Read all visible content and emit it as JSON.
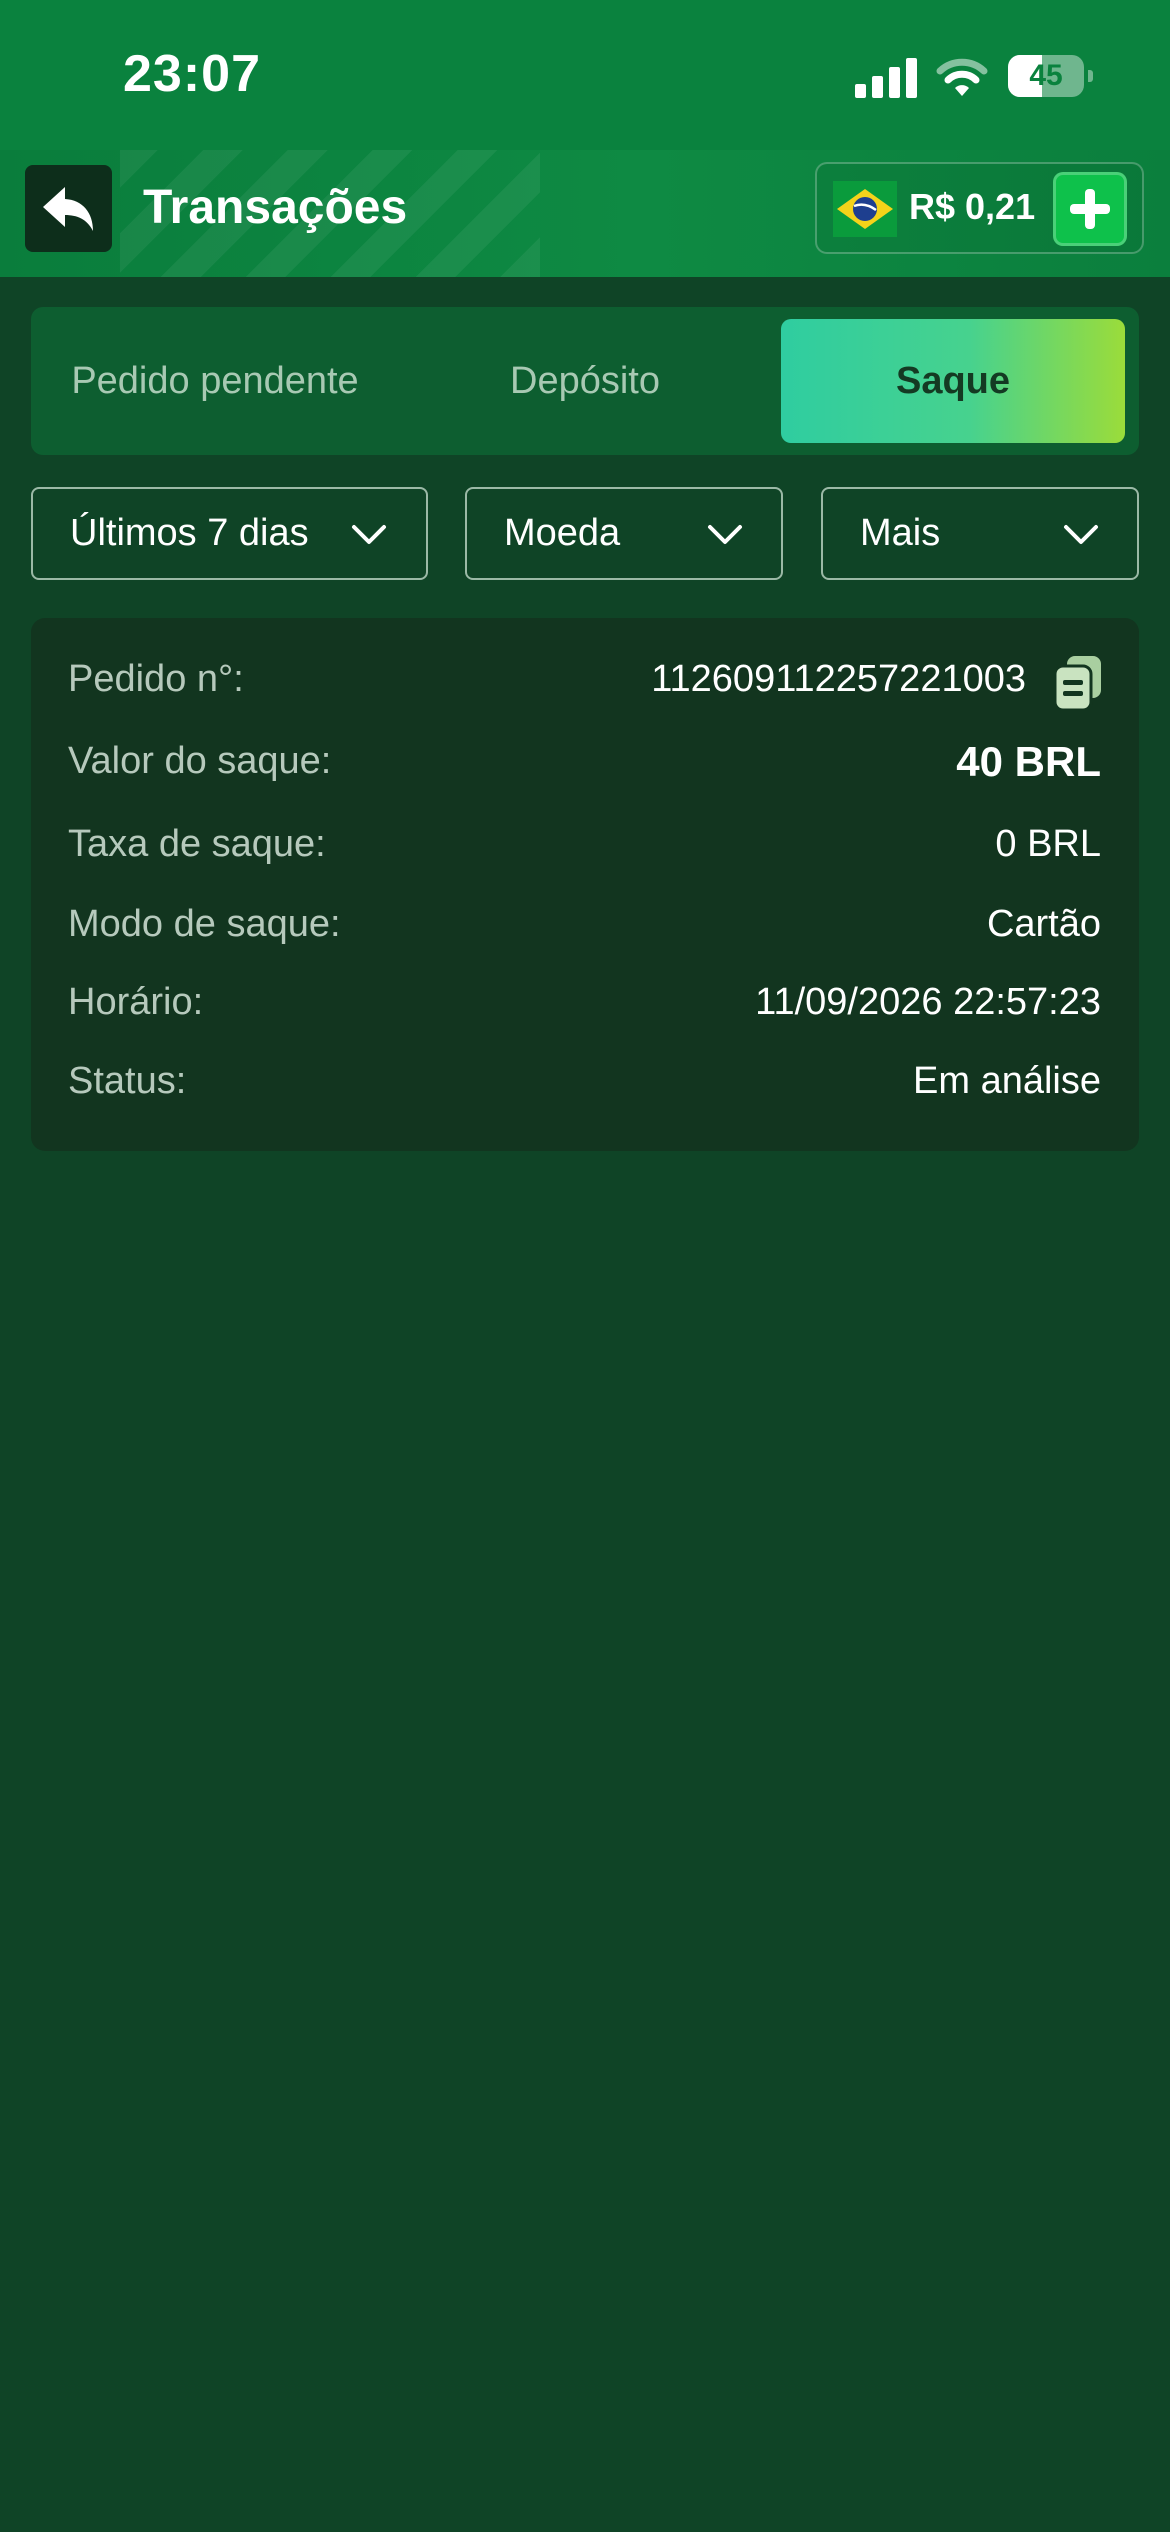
{
  "status_bar": {
    "time": "23:07",
    "battery_level": "45",
    "battery_fraction": 0.45
  },
  "header": {
    "title": "Transações",
    "balance": "R$ 0,21",
    "icons": [
      "back-arrow-icon",
      "brazil-flag-icon",
      "plus-icon"
    ]
  },
  "tabs": [
    {
      "label": "Pedido pendente",
      "active": false
    },
    {
      "label": "Depósito",
      "active": false
    },
    {
      "label": "Saque",
      "active": true
    }
  ],
  "filters": {
    "period": "Últimos 7 dias",
    "currency": "Moeda",
    "more": "Mais"
  },
  "transaction": {
    "order_label": "Pedido n°:",
    "order_value": "112609112257221003",
    "amount_label": "Valor do saque:",
    "amount_value": "40 BRL",
    "fee_label": "Taxa de saque:",
    "fee_value": "0 BRL",
    "mode_label": "Modo de saque:",
    "mode_value": "Cartão",
    "time_label": "Horário:",
    "time_value": "11/09/2026 22:57:23",
    "status_label": "Status:",
    "status_value": "Em análise"
  },
  "colors": {
    "background": "#0f4426",
    "status_bar": "#0a823e",
    "card": "#12351f",
    "active_tab_start": "#2fcda0",
    "active_tab_end": "#9bdc3a",
    "add_button": "#0ec14b"
  }
}
